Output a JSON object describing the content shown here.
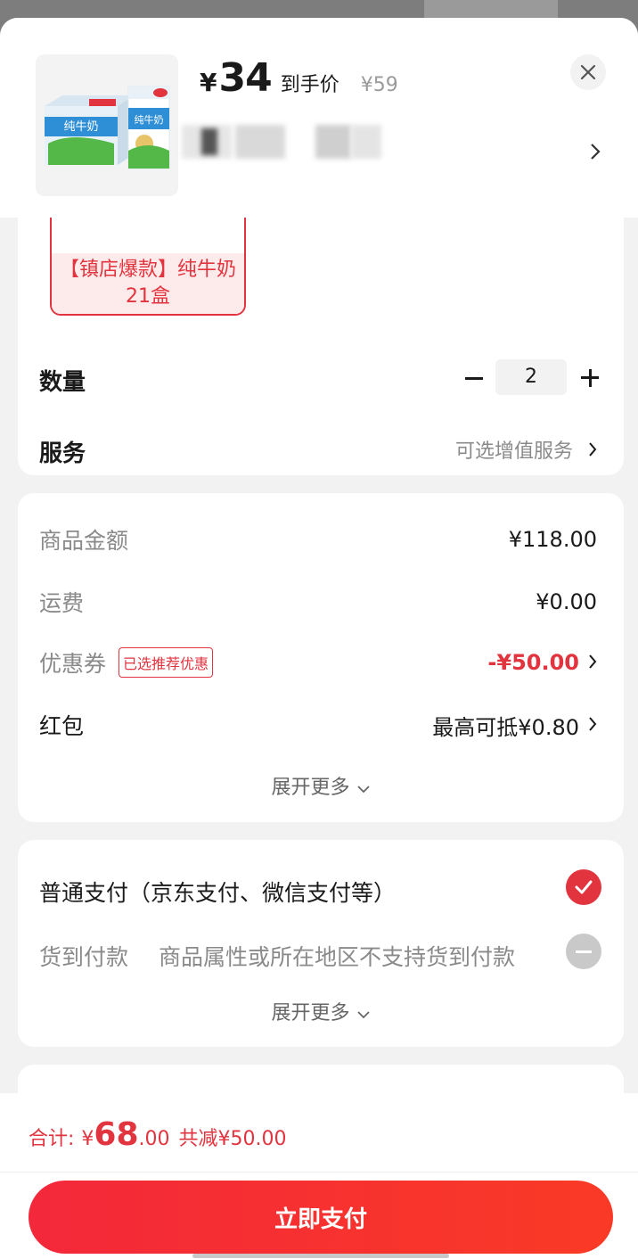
{
  "product": {
    "price_symbol": "¥",
    "price": "34",
    "price_label": "到手价",
    "original_price": "¥59",
    "variant_label": "【镇店爆款】纯牛奶21盒",
    "carton_text": "纯牛奶"
  },
  "options": {
    "quantity_label": "数量",
    "quantity_value": "2",
    "service_label": "服务",
    "service_value": "可选增值服务"
  },
  "summary": {
    "goods_amount_label": "商品金额",
    "goods_amount_value": "¥118.00",
    "shipping_label": "运费",
    "shipping_value": "¥0.00",
    "coupon_label": "优惠券",
    "coupon_tag": "已选推荐优惠",
    "coupon_value": "-¥50.00",
    "redpacket_label": "红包",
    "redpacket_value": "最高可抵¥0.80",
    "expand_more": "展开更多"
  },
  "payment": {
    "normal_label": "普通支付（京东支付、微信支付等）",
    "cod_label": "货到付款",
    "cod_note": "商品属性或所在地区不支持货到付款",
    "expand_more": "展开更多"
  },
  "footer": {
    "total_label": "合计:",
    "total_symbol": "¥",
    "total_int": "68",
    "total_dec": ".00",
    "total_saved": "共减¥50.00",
    "pay_button": "立即支付"
  },
  "colors": {
    "accent": "#e2343f",
    "button_start": "#f3283a",
    "button_end": "#fa3a26"
  },
  "icons": [
    "close-icon",
    "chevron-right-icon",
    "chevron-down-icon",
    "minus-icon",
    "plus-icon",
    "checkmark-icon",
    "disabled-icon"
  ]
}
